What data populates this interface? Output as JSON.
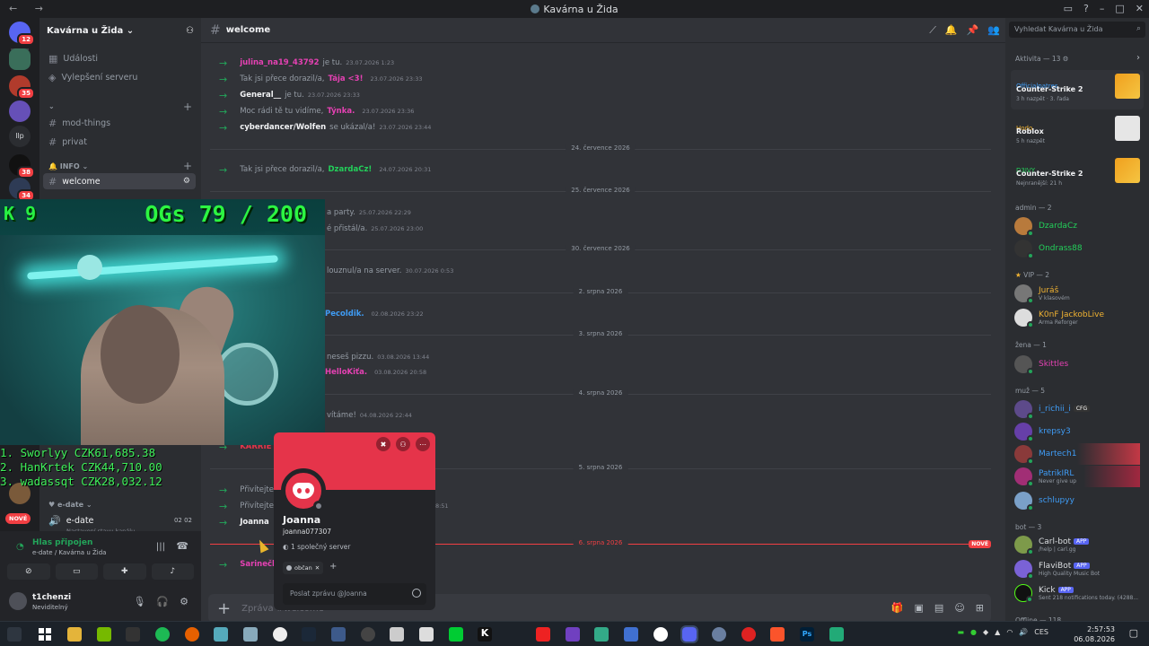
{
  "window": {
    "title": "Kavárna u Žida",
    "nav": "← →"
  },
  "rail": {
    "badges": [
      "12",
      "35",
      "38",
      "34"
    ],
    "llp_label": "llp"
  },
  "sidebar": {
    "server_name": "Kavárna u Žida",
    "items": [
      {
        "label": "Události"
      },
      {
        "label": "Vylepšení serveru"
      }
    ],
    "channels_top": [
      "mod-things",
      "privat"
    ],
    "category_info": "INFO",
    "active_channel": "welcome",
    "category_edate": "e-date",
    "voice_channel": "e-date",
    "voice_counts": "02  02",
    "voice_sub": "Nastavení stavu kanálu",
    "new_label": "NOVÉ"
  },
  "header": {
    "channel": "welcome"
  },
  "messages": [
    {
      "name": "julina_na19_43792",
      "text": "je tu.",
      "ts": "23.07.2026 1:23",
      "color": "#e541b3"
    },
    {
      "pre": "Tak jsi přece dorazil/a,",
      "name": "Tája <3!",
      "ts": "23.07.2026 23:33",
      "color": "#e541b3"
    },
    {
      "name": "General__",
      "text": "je tu.",
      "ts": "23.07.2026 23:33",
      "color": "#f2f3f5"
    },
    {
      "pre": "Moc rádi tě tu vidíme,",
      "name": "Týnka.",
      "ts": "23.07.2026 23:36",
      "color": "#e541b3"
    },
    {
      "name": "cyberdancer/Wolfen",
      "text": "se ukázal/a!",
      "ts": "23.07.2026 23:44",
      "color": "#f2f3f5"
    },
    {
      "pre": "Tak jsi přece dorazil/a,",
      "name": "DzardaCz!",
      "ts": "24.07.2026 20:31",
      "color": "#23d05a"
    },
    {
      "text": "a party.",
      "ts": "25.07.2026 22:29"
    },
    {
      "text": "é přistál/a.",
      "ts": "25.07.2026 23:00"
    },
    {
      "text": "louznul/a na server.",
      "ts": "30.07.2026 0:53"
    },
    {
      "name": "Pecoldik.",
      "ts": "02.08.2026 23:22",
      "color": "#3f9cf5"
    },
    {
      "text": "neseš pizzu.",
      "ts": "03.08.2026 13:44"
    },
    {
      "name": "HelloKiťa.",
      "ts": "03.08.2026 20:58",
      "color": "#e541b3"
    },
    {
      "text": "vítáme!",
      "ts": "04.08.2026 22:44"
    },
    {
      "name": "KARRIE",
      "color": "#e5344a"
    },
    {
      "text": "Přivítejte"
    },
    {
      "text": "Přivítejte",
      "ts": "8:51"
    },
    {
      "name": "Joanna",
      "color": "#f2f3f5"
    },
    {
      "name": "Sarinečk",
      "color": "#e541b3"
    }
  ],
  "separators": [
    "24. července 2026",
    "25. července 2026",
    "30. července 2026",
    "2. srpna 2026",
    "3. srpna 2026",
    "4. srpna 2026",
    "5. srpna 2026"
  ],
  "new_separator": {
    "date": "6. srpna 2026",
    "tag": "NOVÉ"
  },
  "composer": {
    "placeholder": "Zpráva #welcome"
  },
  "members": {
    "search_placeholder": "Vyhledat Kavárna u Žida",
    "activity_header": "Aktivita — 13",
    "activities": [
      {
        "user": "Officialpatres",
        "game": "Counter-Strike 2",
        "meta": "3 h nazpět · 3. řada",
        "color": "#3f9cf5"
      },
      {
        "user": "Hodo",
        "game": "Roblox",
        "meta": "5 h nazpět",
        "color": "#f0b232"
      },
      {
        "user": "D3JVY",
        "game": "Counter-Strike 2",
        "meta": "Nejnranější: 21 h",
        "color": "#23d05a"
      }
    ],
    "groups": [
      {
        "header": "admin — 2",
        "members": [
          {
            "name": "DzardaCz",
            "color": "#23d05a"
          },
          {
            "name": "Ondrass88",
            "color": "#23d05a"
          }
        ]
      },
      {
        "header": "VIP — 2",
        "members": [
          {
            "name": "Juráš",
            "status": "V klasovém",
            "color": "#f0b232"
          },
          {
            "name": "K0nF JackobLive",
            "status": "Arma Reforger",
            "color": "#f0b232"
          }
        ]
      },
      {
        "header": "žena — 1",
        "members": [
          {
            "name": "Skittles",
            "color": "#e541b3"
          }
        ]
      },
      {
        "header": "muž — 5",
        "members": [
          {
            "name": "i_richii_i",
            "tag": "CFG",
            "color": "#3f9cf5"
          },
          {
            "name": "krepsy3",
            "color": "#3f9cf5"
          },
          {
            "name": "Martech1",
            "color": "#3f9cf5"
          },
          {
            "name": "PatrikIRL",
            "status": "Never give up",
            "color": "#3f9cf5"
          },
          {
            "name": "schlupyy",
            "color": "#3f9cf5"
          }
        ]
      },
      {
        "header": "bot — 3",
        "members": [
          {
            "name": "Carl-bot",
            "tag": "APP",
            "status": "/help | carl.gg",
            "color": "#dbdee1"
          },
          {
            "name": "FlaviBot",
            "tag": "APP",
            "status": "High Quality Music Bot",
            "color": "#dbdee1"
          },
          {
            "name": "Kick",
            "tag": "APP",
            "status": "Sent 218 notifications today. (4288...",
            "color": "#dbdee1"
          }
        ]
      }
    ],
    "offline_header": "Offline — 118"
  },
  "overlay": {
    "k_text": "K 9",
    "ogs_text": "OGs 79 / 200",
    "leaders": [
      "1. Sworlyy CZK61,685.38",
      "2. HanKrtek CZK44,710.00",
      "3. wadassqt CZK28,032.12"
    ]
  },
  "popout": {
    "name": "Joanna",
    "username": "joanna077307",
    "mutual": "1 společný server",
    "role": "občan",
    "message_placeholder": "Poslat zprávu @Joanna"
  },
  "voice": {
    "title": "Hlas připojen",
    "subtitle": "e-date / Kavárna u Žida"
  },
  "user": {
    "name": "t1chenzi",
    "status": "Neviditelný"
  },
  "taskbar": {
    "lang": "CES",
    "time": "2:57:53",
    "date": "06.08.2026"
  }
}
